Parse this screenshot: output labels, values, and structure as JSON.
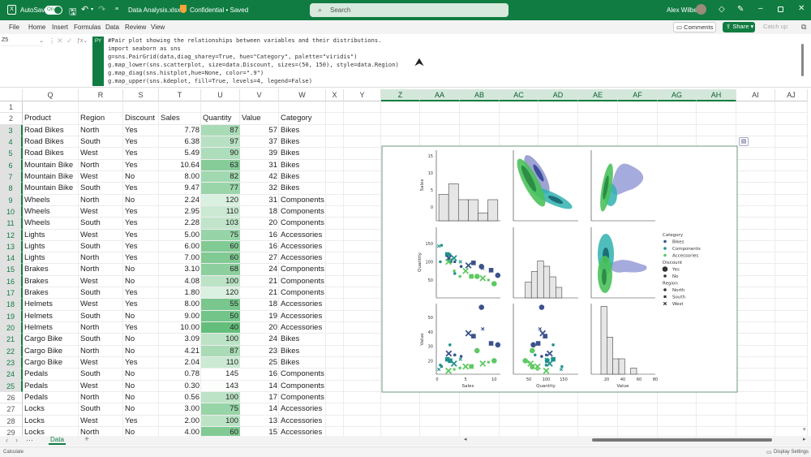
{
  "titlebar": {
    "autosave_label": "AutoSave",
    "toggle_state": "On",
    "file_name": "Data Analysis.xlsx",
    "sensitivity": "Confidential • Saved",
    "search_placeholder": "Search",
    "user_name": "Alex Wilber",
    "brand_color": "#107c41"
  },
  "menu": {
    "items": [
      "File",
      "Home",
      "Insert",
      "Formulas",
      "Data",
      "Review",
      "View"
    ],
    "comments_label": "Comments",
    "share_label": "Share",
    "catchup_label": "Catch up"
  },
  "formula_bar": {
    "name_box": "Z5",
    "badge": "PY",
    "code_lines": [
      "#Pair plot showing the relationships between variables and their distributions.",
      "import seaborn as sns",
      "g=sns.PairGrid(data,diag_sharey=True, hue=\"Category\", palette=\"viridis\")",
      "g.map_lower(sns.scatterplot, size=data.Discount, sizes=(50, 150), style=data.Region)",
      "g.map_diag(sns.histplot,hue=None, color=\".9\")",
      "g.map_upper(sns.kdeplot, fill=True, levels=4, legend=False)"
    ]
  },
  "grid": {
    "columns": [
      "Q",
      "R",
      "S",
      "T",
      "U",
      "V",
      "W",
      "X",
      "Y",
      "Z",
      "AA",
      "AB",
      "AC",
      "AD",
      "AE",
      "AF",
      "AG",
      "AH",
      "AI",
      "AJ"
    ],
    "selected_columns": [
      "Z",
      "AA",
      "AB",
      "AC",
      "AD",
      "AE",
      "AF",
      "AG",
      "AH"
    ],
    "headers": [
      "Product",
      "Region",
      "Discount",
      "Sales",
      "Quantity",
      "Value",
      "Category"
    ],
    "rows": [
      [
        "Road Bikes",
        "North",
        "Yes",
        "7.78",
        "87",
        "57",
        "Bikes"
      ],
      [
        "Road Bikes",
        "South",
        "Yes",
        "6.38",
        "97",
        "37",
        "Bikes"
      ],
      [
        "Road Bikes",
        "West",
        "Yes",
        "5.49",
        "90",
        "39",
        "Bikes"
      ],
      [
        "Mountain Bike",
        "North",
        "Yes",
        "10.64",
        "63",
        "31",
        "Bikes"
      ],
      [
        "Mountain Bike",
        "West",
        "No",
        "8.00",
        "82",
        "42",
        "Bikes"
      ],
      [
        "Mountain Bike",
        "South",
        "Yes",
        "9.47",
        "77",
        "32",
        "Bikes"
      ],
      [
        "Wheels",
        "North",
        "No",
        "2.24",
        "120",
        "31",
        "Components"
      ],
      [
        "Wheels",
        "West",
        "Yes",
        "2.95",
        "110",
        "18",
        "Components"
      ],
      [
        "Wheels",
        "South",
        "Yes",
        "2.28",
        "103",
        "20",
        "Components"
      ],
      [
        "Lights",
        "West",
        "Yes",
        "5.00",
        "75",
        "16",
        "Accessories"
      ],
      [
        "Lights",
        "South",
        "Yes",
        "6.00",
        "60",
        "16",
        "Accessories"
      ],
      [
        "Lights",
        "North",
        "Yes",
        "7.00",
        "60",
        "27",
        "Accessories"
      ],
      [
        "Brakes",
        "North",
        "No",
        "3.10",
        "68",
        "24",
        "Components"
      ],
      [
        "Brakes",
        "West",
        "No",
        "4.08",
        "100",
        "21",
        "Components"
      ],
      [
        "Brakes",
        "South",
        "Yes",
        "1.80",
        "120",
        "21",
        "Components"
      ],
      [
        "Helmets",
        "West",
        "Yes",
        "8.00",
        "55",
        "18",
        "Accessories"
      ],
      [
        "Helmets",
        "South",
        "No",
        "9.00",
        "50",
        "19",
        "Accessories"
      ],
      [
        "Helmets",
        "North",
        "Yes",
        "10.00",
        "40",
        "20",
        "Accessories"
      ],
      [
        "Cargo Bike",
        "South",
        "No",
        "3.09",
        "100",
        "24",
        "Bikes"
      ],
      [
        "Cargo Bike",
        "North",
        "No",
        "4.21",
        "87",
        "23",
        "Bikes"
      ],
      [
        "Cargo Bike",
        "West",
        "Yes",
        "2.04",
        "110",
        "25",
        "Bikes"
      ],
      [
        "Pedals",
        "South",
        "No",
        "0.78",
        "145",
        "16",
        "Components"
      ],
      [
        "Pedals",
        "West",
        "No",
        "0.30",
        "143",
        "14",
        "Components"
      ],
      [
        "Pedals",
        "North",
        "No",
        "0.56",
        "100",
        "17",
        "Components"
      ],
      [
        "Locks",
        "South",
        "No",
        "3.00",
        "75",
        "14",
        "Accessories"
      ],
      [
        "Locks",
        "West",
        "Yes",
        "2.00",
        "100",
        "13",
        "Accessories"
      ],
      [
        "Locks",
        "North",
        "No",
        "4.00",
        "60",
        "15",
        "Accessories"
      ]
    ],
    "quantity_scale_colors": {
      "low": "#63be7b",
      "high": "#ffffff"
    }
  },
  "sheet_tabs": {
    "active": "Data"
  },
  "status": {
    "left": "Calculate",
    "right": "Display Settings"
  },
  "chart_data": {
    "type": "pairplot",
    "variables": [
      "Sales",
      "Quantity",
      "Value"
    ],
    "hue": "Category",
    "palette": {
      "Bikes": "#3b528b",
      "Components": "#21918c",
      "Accessories": "#5ec962"
    },
    "axes": {
      "Sales": {
        "ticks": [
          0,
          5,
          10
        ],
        "diag_ticks": [
          0,
          5,
          10,
          15
        ]
      },
      "Quantity": {
        "ticks": [
          50,
          100,
          150
        ]
      },
      "Value": {
        "ticks": [
          20,
          40,
          60,
          80
        ],
        "y_ticks": [
          20,
          30,
          40,
          50
        ]
      }
    },
    "histograms": {
      "Sales": {
        "edges": [
          0.3,
          2.02,
          3.74,
          5.47,
          7.19,
          8.91,
          10.64
        ],
        "counts": [
          5,
          7,
          4,
          4,
          1.5,
          4
        ]
      },
      "Quantity": {
        "edges": [
          40,
          57.5,
          75,
          92.5,
          110,
          127.5,
          145
        ],
        "counts": [
          3,
          5,
          7,
          6,
          4,
          2
        ]
      },
      "Value": {
        "edges": [
          13,
          20.3,
          27.7,
          35,
          42.3,
          49.7,
          57
        ],
        "counts": [
          11,
          6,
          2.5,
          2.5,
          0,
          1
        ]
      }
    },
    "legend": {
      "placement": "right",
      "sections": [
        {
          "title": "Category",
          "items": [
            "Bikes",
            "Components",
            "Accessories"
          ]
        },
        {
          "title": "Discount",
          "items": [
            "Yes",
            "No"
          ]
        },
        {
          "title": "Region",
          "items": [
            "North",
            "South",
            "West"
          ]
        }
      ]
    }
  }
}
